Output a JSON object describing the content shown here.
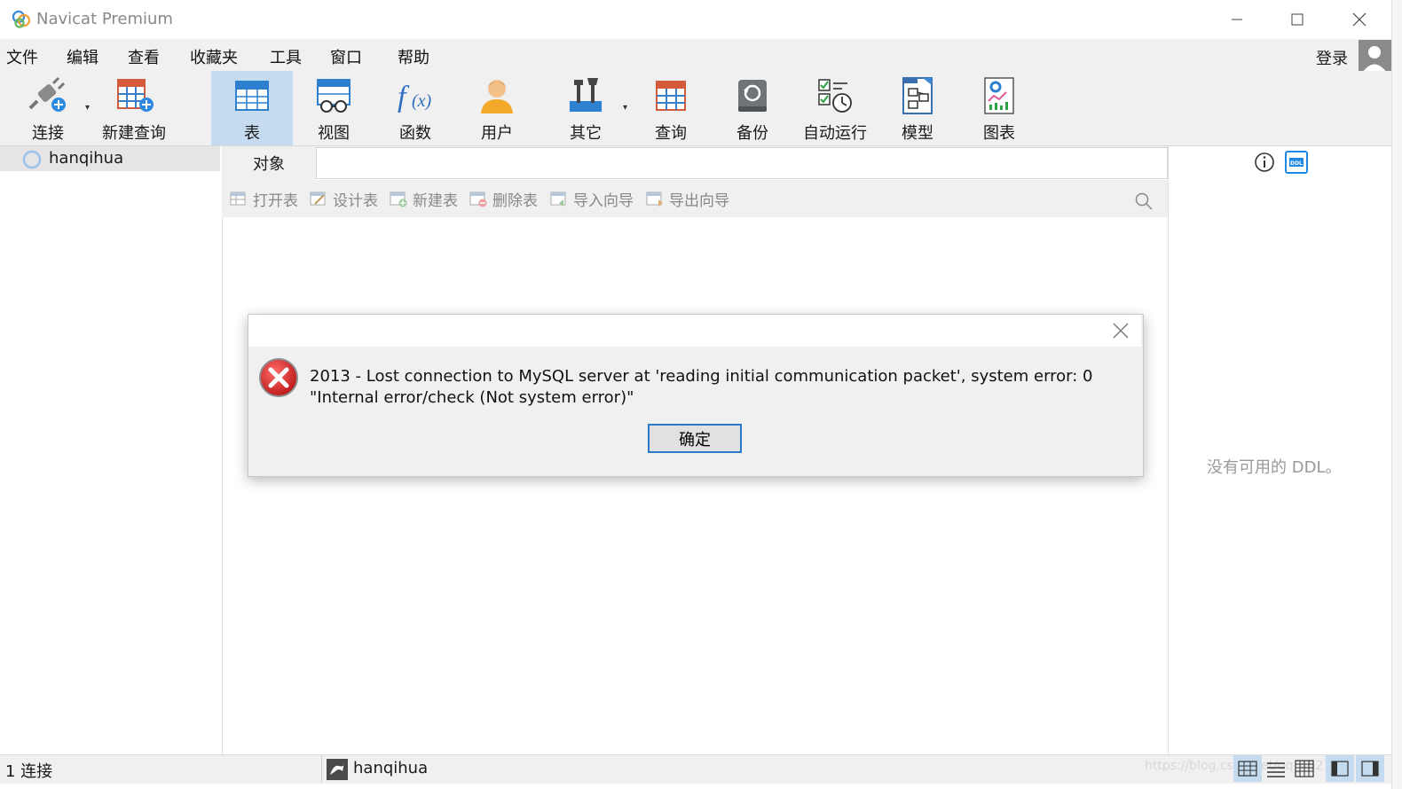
{
  "window": {
    "title": "Navicat Premium"
  },
  "menu": [
    "文件",
    "编辑",
    "查看",
    "收藏夹",
    "工具",
    "窗口",
    "帮助"
  ],
  "account": {
    "login_label": "登录"
  },
  "toolbar": {
    "items": [
      {
        "label": "连接",
        "icon": "plug-connect-icon"
      },
      {
        "label": "新建查询",
        "icon": "new-query-icon"
      },
      {
        "label": "表",
        "icon": "table-icon",
        "active": true
      },
      {
        "label": "视图",
        "icon": "view-icon"
      },
      {
        "label": "函数",
        "icon": "function-icon"
      },
      {
        "label": "用户",
        "icon": "user-icon"
      },
      {
        "label": "其它",
        "icon": "tools-icon"
      },
      {
        "label": "查询",
        "icon": "query-icon"
      },
      {
        "label": "备份",
        "icon": "backup-icon"
      },
      {
        "label": "自动运行",
        "icon": "automation-icon"
      },
      {
        "label": "模型",
        "icon": "model-icon"
      },
      {
        "label": "图表",
        "icon": "chart-icon"
      }
    ]
  },
  "sidebar": {
    "connection": "hanqihua"
  },
  "tabs": {
    "objects": "对象"
  },
  "object_toolbar": [
    "打开表",
    "设计表",
    "新建表",
    "删除表",
    "导入向导",
    "导出向导"
  ],
  "right_panel": {
    "empty_ddl": "没有可用的 DDL。"
  },
  "dialog": {
    "message": "2013 - Lost connection to MySQL server at 'reading initial communication packet', system error: 0 \"Internal error/check (Not system error)\"",
    "ok_label": "确定"
  },
  "status": {
    "connections": "1 连接",
    "current_connection": "hanqihua"
  },
  "watermark": "https://blog.csdn.net/qq_4627716",
  "colors": {
    "active_tab": "#c5dcf0",
    "accent": "#2a78c8",
    "error": "#d42b2b"
  }
}
